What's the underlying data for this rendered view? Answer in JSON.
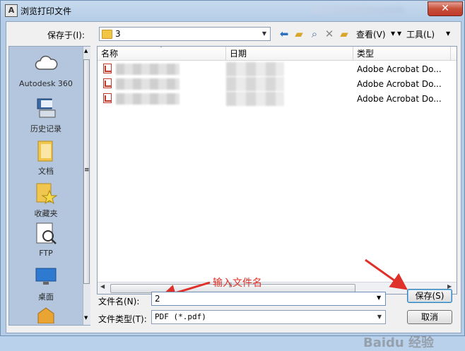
{
  "window": {
    "title": "浏览打印文件",
    "app_icon": "A"
  },
  "toolbar": {
    "save_in_label": "保存于(I):",
    "save_in_value": "3",
    "view_label": "查看(V)",
    "tools_label": "工具(L)"
  },
  "places": [
    {
      "label": "Autodesk 360",
      "icon": "cloud-icon"
    },
    {
      "label": "历史记录",
      "icon": "history-icon"
    },
    {
      "label": "文档",
      "icon": "documents-folder-icon"
    },
    {
      "label": "收藏夹",
      "icon": "favorites-folder-icon"
    },
    {
      "label": "FTP",
      "icon": "ftp-icon"
    },
    {
      "label": "桌面",
      "icon": "desktop-icon"
    }
  ],
  "columns": {
    "name": "名称",
    "date": "日期",
    "type": "类型"
  },
  "files": [
    {
      "type": "Adobe Acrobat Do..."
    },
    {
      "type": "Adobe Acrobat Do..."
    },
    {
      "type": "Adobe Acrobat Do..."
    }
  ],
  "filename": {
    "label": "文件名(N):",
    "value": "2"
  },
  "filetype": {
    "label": "文件类型(T):",
    "value": "PDF (*.pdf)"
  },
  "buttons": {
    "save": "保存(S)",
    "cancel": "取消"
  },
  "annotation": {
    "text": "输入文件名",
    "color": "#e0302a"
  },
  "watermark": "Baidu 经验"
}
